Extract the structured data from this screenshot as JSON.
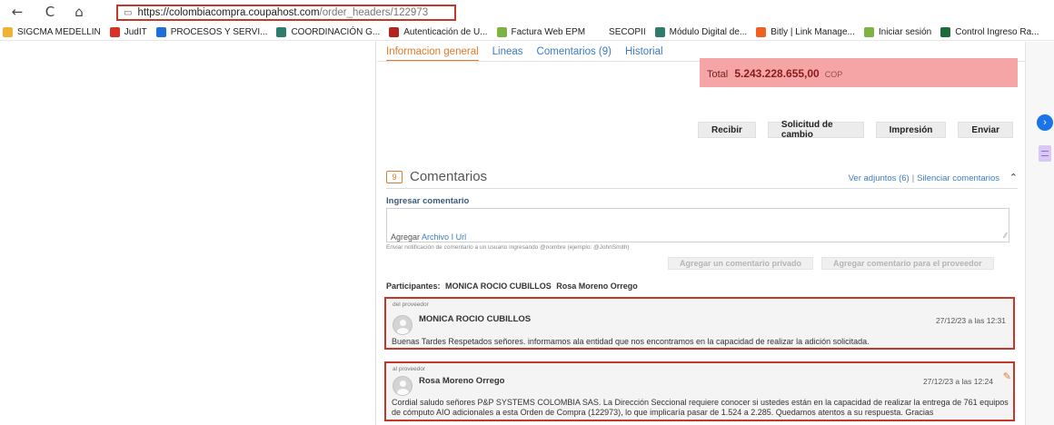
{
  "browser": {
    "back_icon": "←",
    "reload_icon": "C",
    "home_icon": "⌂",
    "url_host": "https://colombiacompra.coupahost.com",
    "url_path": "/order_headers/122973",
    "bookmarks": [
      {
        "label": "SIGCMA MEDELLIN",
        "color": "#f2b134"
      },
      {
        "label": "JudIT",
        "color": "#d93025"
      },
      {
        "label": "PROCESOS Y SERVI...",
        "color": "#1e6fd9"
      },
      {
        "label": "COORDINACIÓN G...",
        "color": "#2e7d6b"
      },
      {
        "label": "Autenticación de U...",
        "color": "#b3261e"
      },
      {
        "label": "Factura Web EPM",
        "color": "#7cb342"
      },
      {
        "label": "SECOPII",
        "color": "#ffffff"
      },
      {
        "label": "Módulo Digital de...",
        "color": "#2e7d6b"
      },
      {
        "label": "Bitly | Link Manage...",
        "color": "#ee6123"
      },
      {
        "label": "Iniciar sesión",
        "color": "#7cb342"
      },
      {
        "label": "Control Ingreso Ra...",
        "color": "#1d6b3a"
      }
    ]
  },
  "tabs": [
    {
      "label": "Informacion general",
      "active": true
    },
    {
      "label": "Lineas",
      "active": false
    },
    {
      "label": "Comentarios (9)",
      "active": false
    },
    {
      "label": "Historial",
      "active": false
    }
  ],
  "total": {
    "label": "Total",
    "amount": "5.243.228.655,00",
    "currency": "COP"
  },
  "actions": {
    "recibir": "Recibir",
    "solicitud": "Solicitud de cambio",
    "impresion": "Impresión",
    "enviar": "Enviar"
  },
  "comments_section": {
    "count": "9",
    "title": "Comentarios",
    "ver_adjuntos": "Ver adjuntos (6)",
    "separator": "|",
    "silenciar": "Silenciar comentarios",
    "caret": "⌃",
    "ingresar_label": "Ingresar comentario",
    "agregar": "Agregar",
    "archivo": "Archivo",
    "link_sep": "I",
    "url": "Url",
    "notify_hint": "Enviar notificación de comentario a un usuario ingresando @nombre (ejemplo: @JohnSmith)",
    "private_btn": "Agregar un comentario privado",
    "supplier_btn": "Agregar comentario para el proveedor",
    "participants_label": "Participantes:",
    "participants": [
      "MONICA ROCIO CUBILLOS",
      "Rosa Moreno Orrego"
    ]
  },
  "comments": [
    {
      "direction": "del proveedor",
      "author": "MONICA ROCIO CUBILLOS",
      "date": "27/12/23 a las 12:31",
      "text": "Buenas Tardes Respetados señores. informamos ala entidad que nos encontramos en la capacidad de realizar la adición solicitada."
    },
    {
      "direction": "al proveedor",
      "author": "Rosa Moreno Orrego",
      "date": "27/12/23 a las 12:24",
      "edit_icon": "✎",
      "text": "Cordial saludo señores P&P SYSTEMS COLOMBIA SAS. La Dirección Seccional requiere conocer si ustedes están en la capacidad de realizar la entrega de 761 equipos de cómputo AIO adicionales a esta Orden de Compra (122973), lo que implicaría pasar de 1.524 a 2.285. Quedamos atentos a su respuesta. Gracias"
    }
  ]
}
